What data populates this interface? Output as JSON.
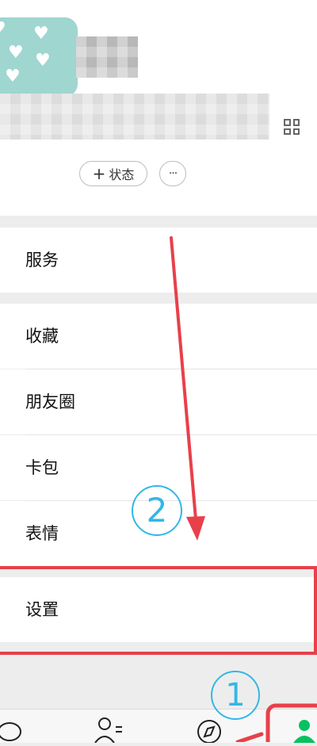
{
  "profile": {
    "status_button": "状态",
    "status_plus": "+",
    "more_label": "···"
  },
  "menu": {
    "services": "服务",
    "favorites": "收藏",
    "moments": "朋友圈",
    "cards": "卡包",
    "stickers": "表情",
    "settings": "设置"
  },
  "annotations": {
    "step1": "①",
    "step2": "②",
    "color": "#e8404a",
    "circle_color": "#32b7e6"
  },
  "tabs": {
    "active_color": "#07c160",
    "icons": [
      "chat-icon",
      "contacts-icon",
      "discover-icon",
      "me-icon"
    ]
  }
}
